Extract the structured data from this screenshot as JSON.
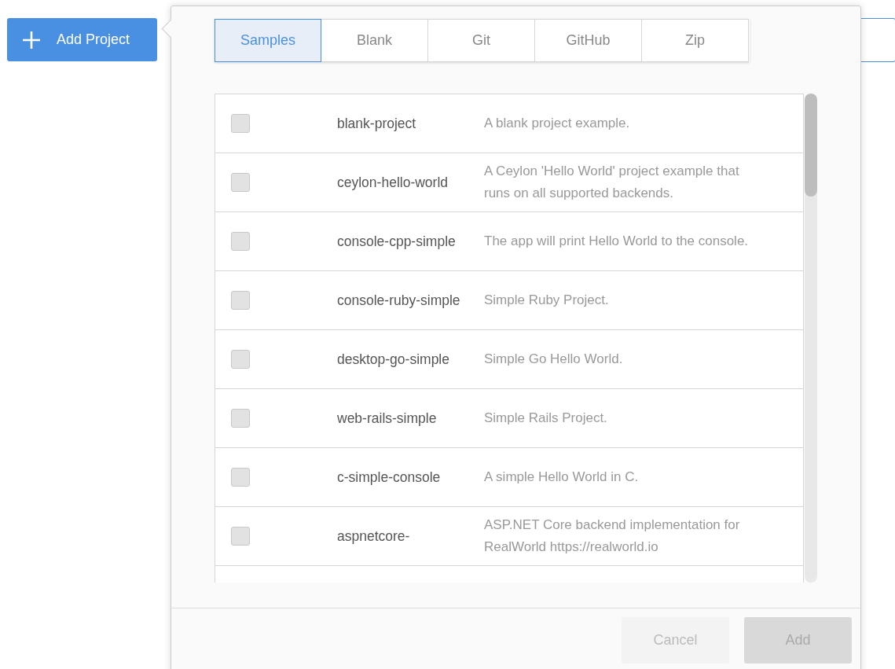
{
  "add_project_button": {
    "label": "Add Project"
  },
  "tabs": [
    {
      "label": "Samples",
      "selected": true
    },
    {
      "label": "Blank",
      "selected": false
    },
    {
      "label": "Git",
      "selected": false
    },
    {
      "label": "GitHub",
      "selected": false
    },
    {
      "label": "Zip",
      "selected": false
    }
  ],
  "samples": [
    {
      "name": "blank-project",
      "description": "A blank project example.",
      "checked": false
    },
    {
      "name": "ceylon-hello-world",
      "description": "A Ceylon 'Hello World' project example that runs on all supported backends.",
      "checked": false
    },
    {
      "name": "console-cpp-simple",
      "description": "The app will print Hello World to the console.",
      "checked": false
    },
    {
      "name": "console-ruby-simple",
      "description": "Simple Ruby Project.",
      "checked": false
    },
    {
      "name": "desktop-go-simple",
      "description": "Simple Go Hello World.",
      "checked": false
    },
    {
      "name": "web-rails-simple",
      "description": "Simple Rails Project.",
      "checked": false
    },
    {
      "name": "c-simple-console",
      "description": "A simple Hello World in C.",
      "checked": false
    },
    {
      "name": "aspnetcore-",
      "description": "ASP.NET Core backend implementation for RealWorld https://realworld.io",
      "checked": false
    }
  ],
  "buttons": [
    {
      "label": "Cancel",
      "kind": "secondary",
      "disabled": true
    },
    {
      "label": "Add",
      "kind": "primary",
      "disabled": true
    }
  ]
}
